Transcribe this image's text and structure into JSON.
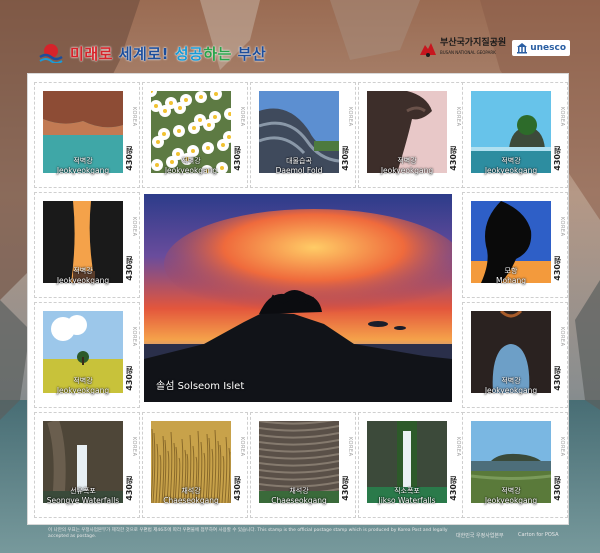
{
  "header": {
    "slogan": [
      "미",
      "래",
      "로",
      " ",
      "세",
      "계",
      "로",
      "!",
      " ",
      "성",
      "공",
      "하",
      "는",
      " ",
      "부",
      "산"
    ],
    "geopark_label_ko": "부산국가지질공원",
    "geopark_label_en": "BUSAN NATIONAL GEOPARK",
    "unesco_label": "unesco"
  },
  "colors": {
    "slogan": [
      "#d6232a",
      "#d6232a",
      "#d6232a",
      "#ffffff",
      "#1c4e9c",
      "#1c4e9c",
      "#1c4e9c",
      "#1c4e9c",
      "#ffffff",
      "#1a9bd7",
      "#1a9bd7",
      "#2aa34a",
      "#2aa34a",
      "#ffffff",
      "#1c4e9c",
      "#1c4e9c"
    ],
    "sheet": "#ffffff",
    "geopark_mark": "#c7161e"
  },
  "stamps": [
    {
      "ko": "적벽강",
      "en": "Jeokyeokgang",
      "denom": "430원"
    },
    {
      "ko": "적벽강",
      "en": "Jeokyeokgang",
      "denom": "430원"
    },
    {
      "ko": "대물습곡",
      "en": "Daemol Fold",
      "denom": "430원"
    },
    {
      "ko": "적벽강",
      "en": "Jeokyeokgang",
      "denom": "430원"
    },
    {
      "ko": "적벽강",
      "en": "Jeokyeokgang",
      "denom": "430원"
    },
    {
      "ko": "적벽강",
      "en": "Jeokyeokgang",
      "denom": "430원"
    },
    {
      "ko": "모항",
      "en": "Mohang",
      "denom": "430원"
    },
    {
      "ko": "적벽강",
      "en": "Jeokyeokgang",
      "denom": "430원"
    },
    {
      "ko": "적벽강",
      "en": "Jeokyeokgang",
      "denom": "430원"
    },
    {
      "ko": "선유폭포",
      "en": "Seongye Waterfalls",
      "denom": "430원"
    },
    {
      "ko": "채석강",
      "en": "Chaeseokgang",
      "denom": "430원"
    },
    {
      "ko": "채석강",
      "en": "Chaeseokgang",
      "denom": "430원"
    },
    {
      "ko": "직소폭포",
      "en": "Jikso Waterfalls",
      "denom": "430원"
    },
    {
      "ko": "적벽강",
      "en": "Jeokyeokgang",
      "denom": "430원"
    }
  ],
  "korea_text": "KOREA",
  "feature": {
    "title": "솔섬  Solseom Islet"
  },
  "footer": {
    "note": "이 나만의 우표는 우정사업본부가 제작한 것으로 우편법 제46조에 따라 우편물에 첨부하여 사용할 수 있습니다. This stamp is the official postage stamp which is produced by Korea Post and legally accepted as postage.",
    "org": "대한민국 우정사업본부",
    "credit": "Carton for POSA"
  }
}
